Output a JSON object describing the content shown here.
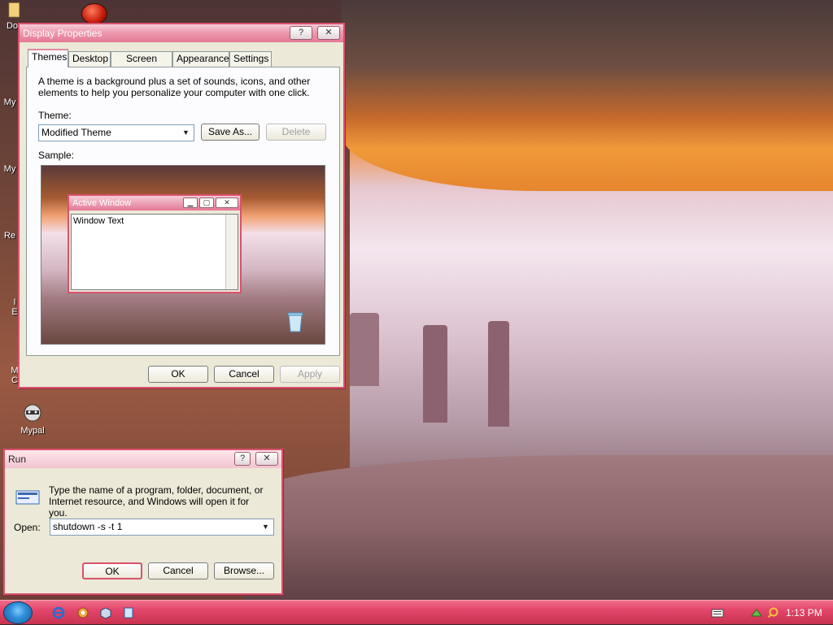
{
  "desktop": {
    "icons": [
      {
        "label": "Do"
      },
      {
        "label": "My"
      },
      {
        "label": "My"
      },
      {
        "label": "Re"
      },
      {
        "label": "I"
      },
      {
        "label": "E"
      },
      {
        "label": "M"
      },
      {
        "label": "C"
      },
      {
        "label": "Mypal"
      }
    ]
  },
  "display_properties": {
    "title": "Display Properties",
    "help_btn": "?",
    "close_btn": "✕",
    "tabs": [
      {
        "label": "Themes"
      },
      {
        "label": "Desktop"
      },
      {
        "label": "Screen Saver"
      },
      {
        "label": "Appearance"
      },
      {
        "label": "Settings"
      }
    ],
    "description": "A theme is a background plus a set of sounds, icons, and other elements to help you personalize your computer with one click.",
    "theme_label": "Theme:",
    "theme_value": "Modified Theme",
    "save_as": "Save As...",
    "delete": "Delete",
    "sample_label": "Sample:",
    "sample_window": {
      "title": "Active Window",
      "text": "Window Text"
    },
    "ok": "OK",
    "cancel": "Cancel",
    "apply": "Apply"
  },
  "run_dialog": {
    "title": "Run",
    "help_btn": "?",
    "close_btn": "✕",
    "description": "Type the name of a program, folder, document, or Internet resource, and Windows will open it for you.",
    "open_label": "Open:",
    "open_value": "shutdown -s -t 1",
    "ok": "OK",
    "cancel": "Cancel",
    "browse": "Browse..."
  },
  "taskbar": {
    "clock": "1:13 PM",
    "quick_launch": [
      "internet-explorer-icon",
      "mozilla-icon",
      "box-icon",
      "app-icon"
    ]
  },
  "colors": {
    "accent": "#d9526d",
    "taskbar": "#e2456a"
  }
}
